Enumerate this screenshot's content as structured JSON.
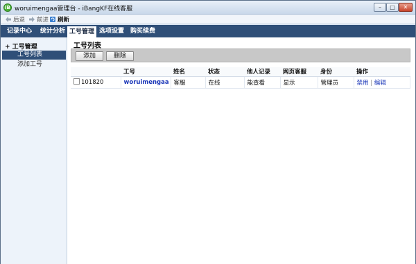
{
  "window": {
    "title": "woruimengaa管理台 - iBangKF在线客服",
    "app_icon_text": "iB"
  },
  "nav": {
    "back": "后退",
    "forward": "前进",
    "refresh": "刷新"
  },
  "menu": [
    {
      "label": "记录中心",
      "active": false
    },
    {
      "label": "统计分析",
      "active": false
    },
    {
      "label": "工号管理",
      "active": true
    },
    {
      "label": "选项设置",
      "active": false
    },
    {
      "label": "购买续费",
      "active": false
    }
  ],
  "sidebar": {
    "heading": "+ 工号管理",
    "items": [
      {
        "label": "工号列表",
        "active": true
      },
      {
        "label": "添加工号",
        "active": false
      }
    ]
  },
  "main": {
    "title": "工号列表",
    "toolbar": {
      "add": "添加",
      "delete": "删除"
    },
    "columns": [
      "",
      "工号",
      "姓名",
      "状态",
      "他人记录",
      "网页客服",
      "身份",
      "操作"
    ],
    "rows": [
      {
        "id": "101820",
        "account": "woruimengaa",
        "name": "客服",
        "status": "在线",
        "others_records": "能查看",
        "web_service": "显示",
        "role": "管理员",
        "actions": [
          "禁用",
          "编辑"
        ]
      }
    ]
  },
  "colors": {
    "menubar": "#2f4f78",
    "link": "#1a36b8"
  }
}
